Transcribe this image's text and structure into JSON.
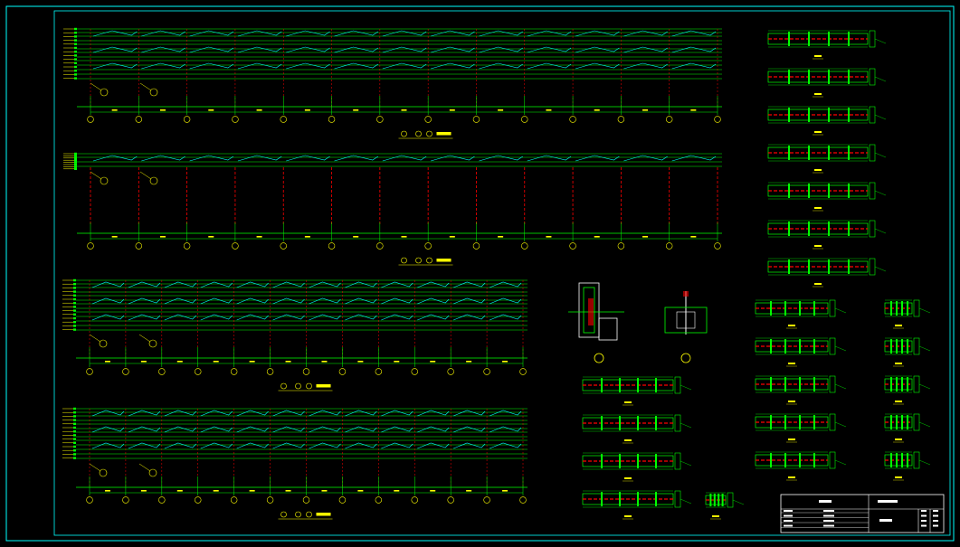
{
  "colors": {
    "background": "#000000",
    "frame": "#00ffff",
    "structure": "#00ff00",
    "bracing": "#00ffff",
    "columns": "#ff0000",
    "text": "#ffff00",
    "titleblock": "#ffffff"
  },
  "elevations": [
    {
      "grid_count": 14,
      "levels": 6,
      "bracing_levels": 3,
      "has_gap": false
    },
    {
      "grid_count": 14,
      "levels": 2,
      "bracing_levels": 1,
      "has_gap": true
    },
    {
      "grid_count": 13,
      "levels": 6,
      "bracing_levels": 3,
      "has_gap": false
    },
    {
      "grid_count": 13,
      "levels": 6,
      "bracing_levels": 3,
      "has_gap": false
    }
  ],
  "details": {
    "right_beams": 7,
    "mid_beams": 4,
    "small_beams_a": 5,
    "small_beams_b": 5,
    "tiny_beams": 5
  },
  "titleblock": {
    "header": "",
    "rows": 4
  }
}
